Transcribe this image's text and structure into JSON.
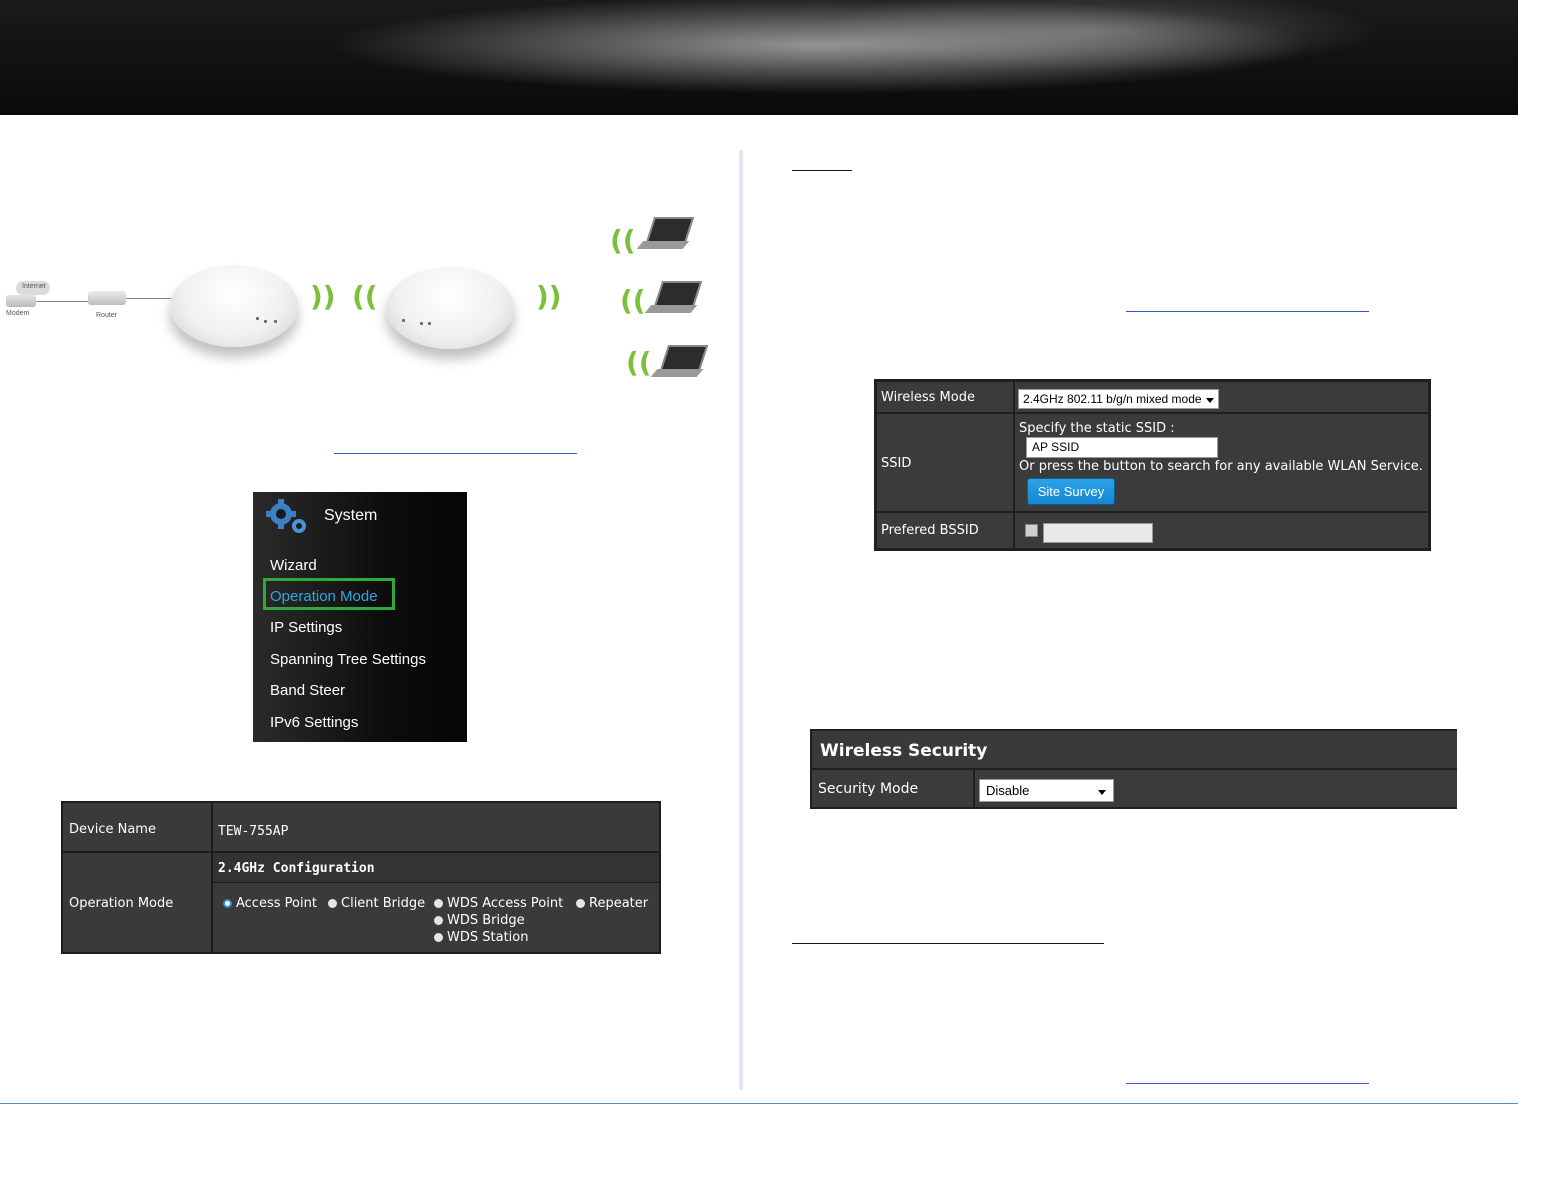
{
  "diagram": {
    "labels": {
      "internet": "Internet",
      "modem": "Modem",
      "router": "Router"
    },
    "wave_glyph": "))",
    "wave_glyph_left": "(("
  },
  "system_menu": {
    "title": "System",
    "items": [
      "Wizard",
      "Operation Mode",
      "IP Settings",
      "Spanning Tree Settings",
      "Band Steer",
      "IPv6 Settings"
    ],
    "highlighted": "Operation Mode",
    "highlight_color": "#2eaa3c"
  },
  "device_table": {
    "device_name_label": "Device Name",
    "device_name_value": "TEW-755AP",
    "operation_mode_label": "Operation Mode",
    "config_header": "2.4GHz Configuration",
    "modes": [
      "Access Point",
      "Client Bridge",
      "WDS Access Point",
      "Repeater",
      "WDS Bridge",
      "WDS Station"
    ],
    "selected_mode": "Access Point"
  },
  "wireless_table": {
    "wireless_mode_label": "Wireless Mode",
    "wireless_mode_value": "2.4GHz 802.11 b/g/n mixed mode",
    "ssid_label": "SSID",
    "ssid_hint": "Specify the static SSID :",
    "ssid_value": "AP SSID",
    "ssid_note": "Or press the button to search for any available WLAN Service.",
    "site_survey_button": "Site Survey",
    "bssid_label": "Prefered BSSID",
    "bssid_value": ""
  },
  "wireless_security": {
    "header": "Wireless Security",
    "security_mode_label": "Security Mode",
    "security_mode_value": "Disable"
  },
  "colors": {
    "accent_blue": "#2c8ecf",
    "menu_selected_text": "#2ea7e0",
    "bottom_rule": "#5b86c5"
  }
}
